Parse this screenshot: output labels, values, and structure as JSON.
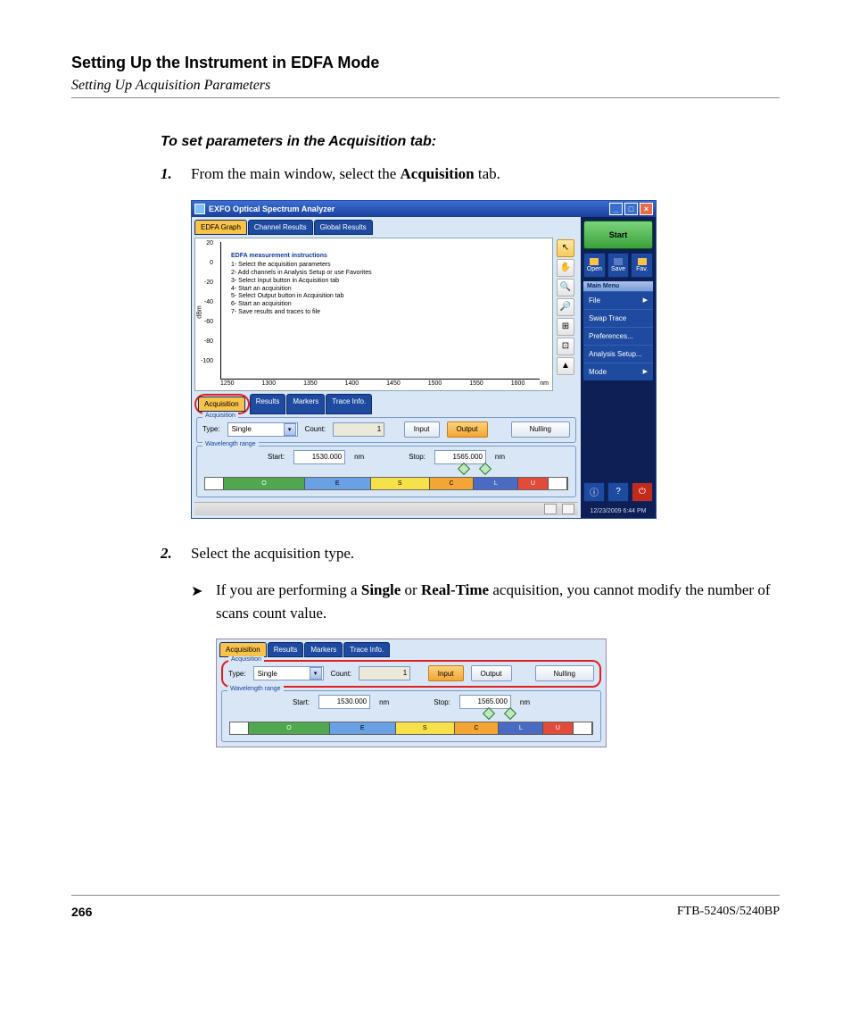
{
  "page": {
    "chapter_heading": "Setting Up the Instrument in EDFA Mode",
    "section_subtitle": "Setting Up Acquisition Parameters",
    "procedure_title": "To set parameters in the Acquisition tab:",
    "step1_num": "1.",
    "step1_a": "From the main window, select the ",
    "step1_b": "Acquisition",
    "step1_c": " tab.",
    "step2_num": "2.",
    "step2_text": "Select the acquisition type.",
    "bullet_a": "If you are performing a ",
    "bullet_b": "Single",
    "bullet_c": " or ",
    "bullet_d": "Real-Time",
    "bullet_e": " acquisition, you cannot modify the number of scans count value.",
    "page_number": "266",
    "doc_id": "FTB-5240S/5240BP"
  },
  "screenshot1": {
    "title": "EXFO Optical Spectrum Analyzer",
    "top_tabs": [
      "EDFA Graph",
      "Channel Results",
      "Global Results"
    ],
    "y_ticks": [
      "20",
      "0",
      "-20",
      "-40",
      "-60",
      "-80",
      "-100"
    ],
    "y_axis_label": "dBm",
    "x_ticks": [
      "1250",
      "1300",
      "1350",
      "1400",
      "1450",
      "1500",
      "1550",
      "1600"
    ],
    "x_unit": "nm",
    "instructions_title": "EDFA measurement instructions",
    "instructions": [
      "1- Select the acquisition parameters",
      "2- Add channels in Analysis Setup or use Favorites",
      "3- Select Input button in Acquisition tab",
      "4- Start an acquisition",
      "5- Select Output button in Acquisition tab",
      "6- Start an acquisition",
      "7- Save results and traces to file"
    ],
    "lower_tabs": [
      "Acquisition",
      "Results",
      "Markers",
      "Trace Info."
    ],
    "acq_legend": "Acquisition",
    "type_label": "Type:",
    "type_value": "Single",
    "count_label": "Count:",
    "count_value": "1",
    "input_btn": "Input",
    "output_btn": "Output",
    "nulling_btn": "Nulling",
    "wl_legend": "Wavelength range",
    "start_label": "Start:",
    "start_value": "1530.000",
    "stop_label": "Stop:",
    "stop_value": "1565.000",
    "unit": "nm",
    "bands": [
      "O",
      "E",
      "S",
      "C",
      "L",
      "U"
    ],
    "right": {
      "start": "Start",
      "open": "Open",
      "save": "Save",
      "fav": "Fav.",
      "main_menu": "Main Menu",
      "items": [
        "File",
        "Swap Trace",
        "Preferences...",
        "Analysis Setup...",
        "Mode"
      ],
      "timestamp": "12/23/2009 6:44 PM"
    }
  },
  "screenshot2": {
    "lower_tabs": [
      "Acquisition",
      "Results",
      "Markers",
      "Trace Info."
    ],
    "acq_legend": "Acquisition",
    "type_label": "Type:",
    "type_value": "Single",
    "count_label": "Count:",
    "count_value": "1",
    "input_btn": "Input",
    "output_btn": "Output",
    "nulling_btn": "Nulling",
    "wl_legend": "Wavelength range",
    "start_label": "Start:",
    "start_value": "1530.000",
    "stop_label": "Stop:",
    "stop_value": "1565.000",
    "unit": "nm",
    "bands": [
      "O",
      "E",
      "S",
      "C",
      "L",
      "U"
    ]
  }
}
